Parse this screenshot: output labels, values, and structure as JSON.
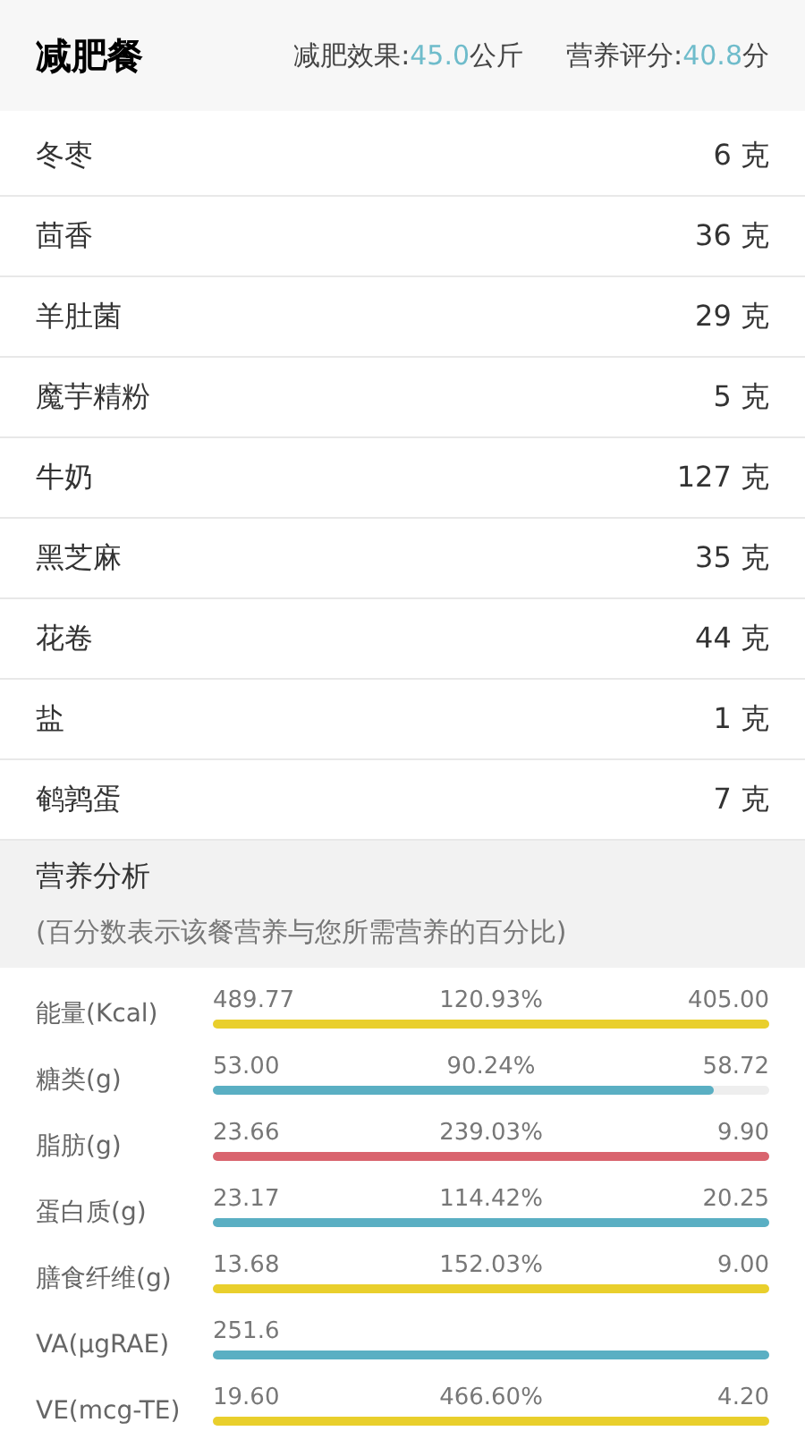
{
  "header": {
    "title": "减肥餐",
    "effect_label": "减肥效果:",
    "effect_value": "45.0",
    "effect_unit": "公斤",
    "score_label": "营养评分:",
    "score_value": "40.8",
    "score_unit": "分"
  },
  "foods": [
    {
      "name": "冬枣",
      "amount": "6 克"
    },
    {
      "name": "茴香",
      "amount": "36 克"
    },
    {
      "name": "羊肚菌",
      "amount": "29 克"
    },
    {
      "name": "魔芋精粉",
      "amount": "5 克"
    },
    {
      "name": "牛奶",
      "amount": "127 克"
    },
    {
      "name": "黑芝麻",
      "amount": "35 克"
    },
    {
      "name": "花卷",
      "amount": "44 克"
    },
    {
      "name": "盐",
      "amount": "1 克"
    },
    {
      "name": "鹌鹑蛋",
      "amount": "7 克"
    }
  ],
  "analysis": {
    "title": "营养分析",
    "note": "(百分数表示该餐营养与您所需营养的百分比)",
    "nutrients": [
      {
        "name": "能量(Kcal)",
        "value": "489.77",
        "percent": "120.93%",
        "target": "405.00",
        "level": 1,
        "color": "#e9cf2c"
      },
      {
        "name": "糖类(g)",
        "value": "53.00",
        "percent": "90.24%",
        "target": "58.72",
        "level": 0.9,
        "color": "#5aafc3"
      },
      {
        "name": "脂肪(g)",
        "value": "23.66",
        "percent": "239.03%",
        "target": "9.90",
        "level": 1,
        "color": "#d9646e"
      },
      {
        "name": "蛋白质(g)",
        "value": "23.17",
        "percent": "114.42%",
        "target": "20.25",
        "level": 1,
        "color": "#5aafc3"
      },
      {
        "name": "膳食纤维(g)",
        "value": "13.68",
        "percent": "152.03%",
        "target": "9.00",
        "level": 1,
        "color": "#e9cf2c"
      },
      {
        "name": "VA(μgRAE)",
        "value": "251.6",
        "level": 1,
        "color": "#5aafc3"
      },
      {
        "name": "VE(mcg-TE)",
        "value": "19.60",
        "percent": "466.60%",
        "target": "4.20",
        "level": 1,
        "color": "#e9cf2c"
      }
    ]
  }
}
